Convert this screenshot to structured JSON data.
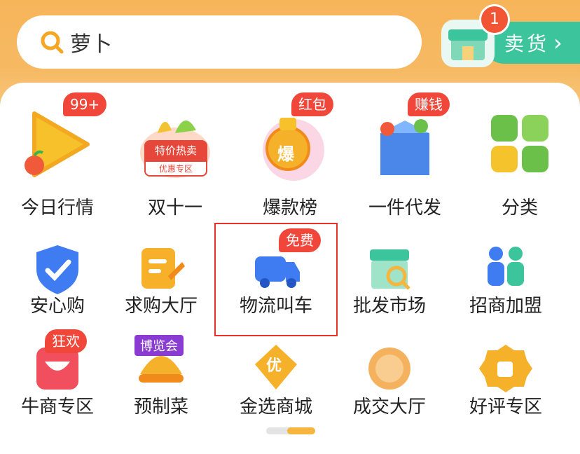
{
  "search": {
    "value": "萝卜"
  },
  "sell": {
    "label": "卖货",
    "badge": "1"
  },
  "row1": [
    {
      "label": "今日行情",
      "tag": "99+"
    },
    {
      "label": "双十一",
      "banner_top": "特价热卖",
      "banner_bottom": "优惠专区"
    },
    {
      "label": "爆款榜",
      "tag": "红包",
      "emblem": "爆"
    },
    {
      "label": "一件代发",
      "tag": "赚钱"
    },
    {
      "label": "分类"
    }
  ],
  "row2": [
    {
      "label": "安心购"
    },
    {
      "label": "求购大厅"
    },
    {
      "label": "物流叫车",
      "tag": "免费"
    },
    {
      "label": "批发市场"
    },
    {
      "label": "招商加盟"
    }
  ],
  "row3": [
    {
      "label": "牛商专区",
      "tag": "狂欢"
    },
    {
      "label": "预制菜",
      "banner": "博览会"
    },
    {
      "label": "金选商城",
      "emblem": "优"
    },
    {
      "label": "成交大厅"
    },
    {
      "label": "好评专区"
    }
  ],
  "colors": {
    "accent": "#f5b53f",
    "green": "#3cc59c",
    "red": "#f1473b",
    "blue": "#3f7cf2"
  }
}
